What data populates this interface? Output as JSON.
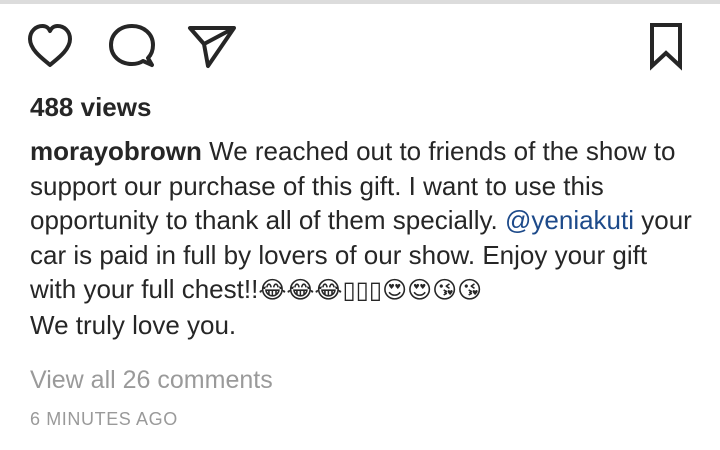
{
  "post": {
    "views": "488 views",
    "caption": {
      "username": "morayobrown",
      "text_before_mention": " We reached out to friends of the show to support our purchase of this gift. I want to use this opportunity to thank all of them specially. ",
      "mention": "@yeniakuti",
      "text_after_mention": " your car is paid in full by lovers of our show. Enjoy your gift with your full chest!!",
      "emojis": "😂😂😂▯▯▯😍😍😘😘",
      "closing_line": "We truly love you."
    },
    "view_comments": "View all 26 comments",
    "timestamp": "6 MINUTES AGO"
  },
  "icons": {
    "like": "heart-icon",
    "comment": "comment-bubble-icon",
    "share": "paper-plane-icon",
    "save": "bookmark-icon"
  },
  "colors": {
    "text": "#262626",
    "muted": "#9a9a9a",
    "mention": "#1d4a8a"
  }
}
